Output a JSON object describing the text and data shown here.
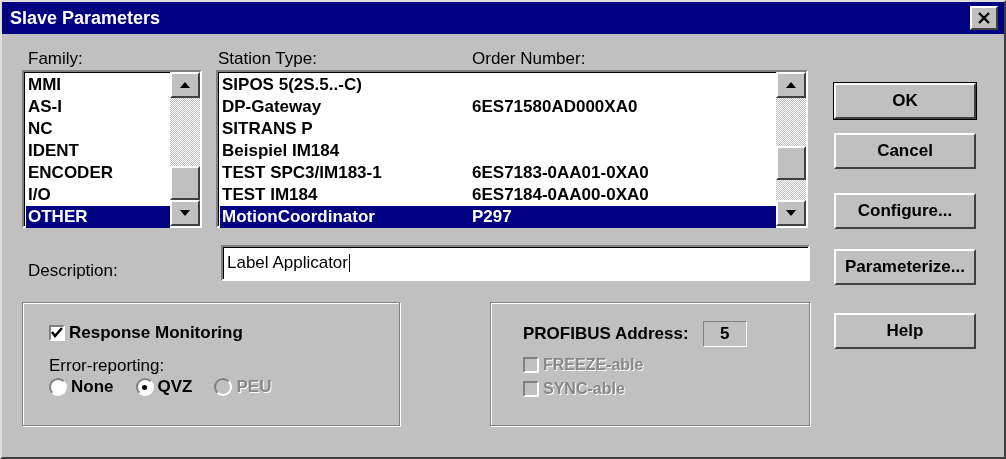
{
  "window": {
    "title": "Slave Parameters"
  },
  "family": {
    "label": "Family:",
    "items": [
      {
        "label": "MMI",
        "selected": false
      },
      {
        "label": "AS-I",
        "selected": false
      },
      {
        "label": "NC",
        "selected": false
      },
      {
        "label": "IDENT",
        "selected": false
      },
      {
        "label": "ENCODER",
        "selected": false
      },
      {
        "label": "I/O",
        "selected": false
      },
      {
        "label": "OTHER",
        "selected": true
      }
    ]
  },
  "station": {
    "label": "Station Type:",
    "order_label": "Order Number:",
    "rows": [
      {
        "station_type": "SIPOS 5(2S.5..-C)",
        "selected": false
      },
      {
        "station_type": "DP-Gateway",
        "order_number": "6ES71580AD000XA0",
        "selected": false
      },
      {
        "station_type": "SITRANS P",
        "selected": false
      },
      {
        "station_type": "Beispiel IM184",
        "selected": false
      },
      {
        "station_type": "TEST SPC3/IM183-1",
        "order_number": "6ES7183-0AA01-0XA0",
        "selected": false
      },
      {
        "station_type": "TEST IM184",
        "order_number": "6ES7184-0AA00-0XA0",
        "selected": false
      },
      {
        "station_type": "MotionCoordinator",
        "order_number": "P297",
        "selected": true
      }
    ]
  },
  "description": {
    "label": "Description:",
    "value": "Label Applicator"
  },
  "buttons": [
    {
      "label": "OK",
      "default": true
    },
    {
      "label": "Cancel",
      "default": false
    },
    {
      "label": "Configure...",
      "default": false
    },
    {
      "label": "Parameterize...",
      "default": false
    },
    {
      "label": "Help",
      "default": false
    }
  ],
  "monitoring": {
    "checkbox": {
      "label": "Response Monitoring",
      "checked": true
    },
    "error_label": "Error-reporting:",
    "options": [
      {
        "label": "None",
        "selected": false,
        "disabled": false
      },
      {
        "label": "QVZ",
        "selected": true,
        "disabled": false
      },
      {
        "label": "PEU",
        "selected": false,
        "disabled": true
      }
    ]
  },
  "profibus": {
    "address_label": "PROFIBUS Address:",
    "address": "5",
    "options": [
      {
        "label": "FREEZE-able",
        "checked": false,
        "disabled": true
      },
      {
        "label": "SYNC-able",
        "checked": false,
        "disabled": true
      }
    ]
  }
}
